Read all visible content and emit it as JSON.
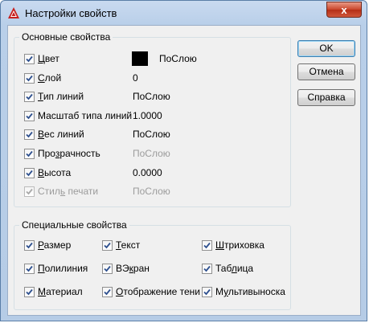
{
  "window": {
    "title": "Настройки свойств",
    "close_glyph": "x"
  },
  "basic": {
    "legend": "Основные свойства",
    "rows": [
      {
        "pre": "",
        "u": "Ц",
        "post": "вет",
        "value": "ПоСлою",
        "checked": true,
        "disabled": false,
        "swatch": "#000000"
      },
      {
        "pre": "",
        "u": "С",
        "post": "лой",
        "value": "0",
        "checked": true,
        "disabled": false
      },
      {
        "pre": "",
        "u": "Т",
        "post": "ип линий",
        "value": "ПоСлою",
        "checked": true,
        "disabled": false
      },
      {
        "pre": "Масштаб типа линий",
        "u": "",
        "post": "",
        "value": "1.0000",
        "checked": true,
        "disabled": false
      },
      {
        "pre": "",
        "u": "В",
        "post": "ес линий",
        "value": "ПоСлою",
        "checked": true,
        "disabled": false
      },
      {
        "pre": "Про",
        "u": "з",
        "post": "рачность",
        "value": "ПоСлою",
        "checked": true,
        "disabled": false,
        "value_disabled": true
      },
      {
        "pre": "",
        "u": "В",
        "post": "ысота",
        "value": "0.0000",
        "checked": true,
        "disabled": false
      },
      {
        "pre": "Стил",
        "u": "ь",
        "post": " печати",
        "value": "ПоСлою",
        "checked": true,
        "disabled": true
      }
    ]
  },
  "special": {
    "legend": "Специальные свойства",
    "items": [
      {
        "pre": "",
        "u": "Р",
        "post": "азмер",
        "checked": true
      },
      {
        "pre": "",
        "u": "Т",
        "post": "екст",
        "checked": true
      },
      {
        "pre": "",
        "u": "Ш",
        "post": "триховка",
        "checked": true
      },
      {
        "pre": "",
        "u": "П",
        "post": "олилиния",
        "checked": true
      },
      {
        "pre": "ВЭ",
        "u": "к",
        "post": "ран",
        "checked": true
      },
      {
        "pre": "Таб",
        "u": "л",
        "post": "ица",
        "checked": true
      },
      {
        "pre": "",
        "u": "М",
        "post": "атериал",
        "checked": true
      },
      {
        "pre": "",
        "u": "О",
        "post": "тображение тени",
        "checked": true
      },
      {
        "pre": "М",
        "u": "у",
        "post": "льтивыноска",
        "checked": true
      }
    ]
  },
  "buttons": {
    "ok": "OK",
    "cancel": "Отмена",
    "help": "Справка"
  },
  "colors": {
    "accent": "#3c7fb1",
    "check": "#2d4f8e",
    "disabled_text": "#9c9c9c"
  }
}
